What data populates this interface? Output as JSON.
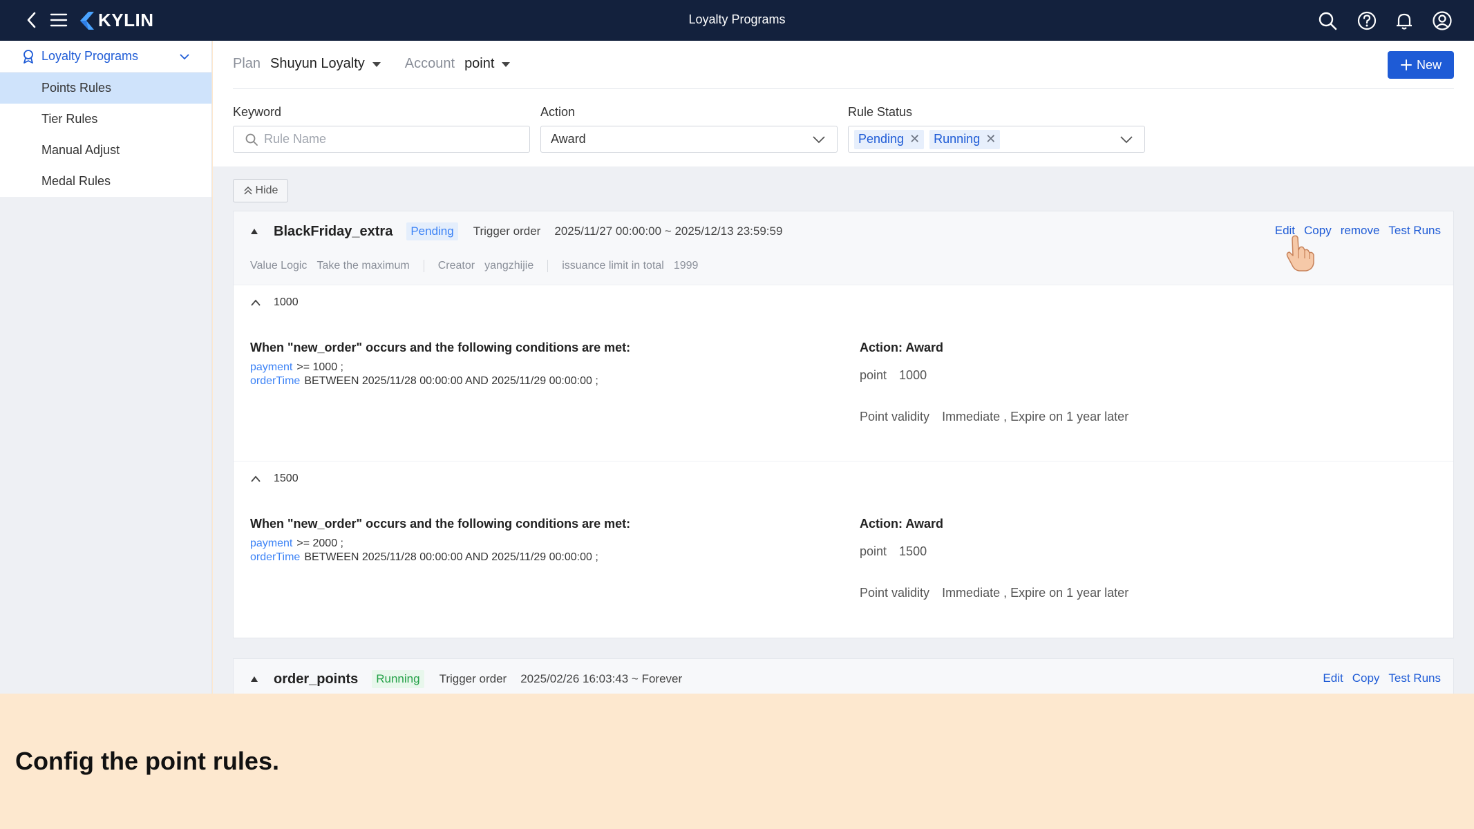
{
  "topbar": {
    "brand": "KYLIN",
    "title": "Loyalty Programs"
  },
  "sidebar": {
    "group_label": "Loyalty Programs",
    "items": [
      {
        "label": "Points Rules",
        "active": true
      },
      {
        "label": "Tier Rules",
        "active": false
      },
      {
        "label": "Manual Adjust",
        "active": false
      },
      {
        "label": "Medal Rules",
        "active": false
      }
    ]
  },
  "header": {
    "plan_label": "Plan",
    "plan_value": "Shuyun Loyalty",
    "account_label": "Account",
    "account_value": "point",
    "new_button": "New"
  },
  "filters": {
    "keyword_label": "Keyword",
    "keyword_placeholder": "Rule Name",
    "action_label": "Action",
    "action_value": "Award",
    "status_label": "Rule Status",
    "status_tags": [
      "Pending",
      "Running"
    ],
    "hide_button": "Hide"
  },
  "rules": [
    {
      "name": "BlackFriday_extra",
      "status": "Pending",
      "trigger": "Trigger order",
      "period": "2025/11/27 00:00:00 ~ 2025/12/13 23:59:59",
      "actions": [
        "Edit",
        "Copy",
        "remove",
        "Test Runs"
      ],
      "meta": {
        "value_logic_label": "Value Logic",
        "value_logic": "Take the maximum",
        "creator_label": "Creator",
        "creator": "yangzhijie",
        "limit_label": "issuance limit in total",
        "limit": "1999"
      },
      "tiers": [
        {
          "title": "1000",
          "condition_title": "When \"new_order\" occurs and the following conditions are met:",
          "conditions": [
            {
              "field": "payment",
              "expr": ">= 1000 ;"
            },
            {
              "field": "orderTime",
              "expr": "BETWEEN 2025/11/28 00:00:00 AND 2025/11/29 00:00:00 ;"
            }
          ],
          "action_title": "Action: Award",
          "point_label": "point",
          "point_value": "1000",
          "validity_label": "Point validity",
          "validity_value": "Immediate , Expire on 1 year later"
        },
        {
          "title": "1500",
          "condition_title": "When \"new_order\" occurs and the following conditions are met:",
          "conditions": [
            {
              "field": "payment",
              "expr": ">= 2000 ;"
            },
            {
              "field": "orderTime",
              "expr": "BETWEEN 2025/11/28 00:00:00 AND 2025/11/29 00:00:00 ;"
            }
          ],
          "action_title": "Action: Award",
          "point_label": "point",
          "point_value": "1500",
          "validity_label": "Point validity",
          "validity_value": "Immediate , Expire on 1 year later"
        }
      ]
    },
    {
      "name": "order_points",
      "status": "Running",
      "trigger": "Trigger order",
      "period": "2025/02/26 16:03:43 ~ Forever",
      "actions": [
        "Edit",
        "Copy",
        "Test Runs"
      ]
    }
  ],
  "caption": "Config the point rules.",
  "colors": {
    "topbar": "#13213d",
    "accent": "#1e5bd6",
    "pending": "#3b82f6",
    "running": "#22a046",
    "caption_bg": "#fde8cf"
  }
}
